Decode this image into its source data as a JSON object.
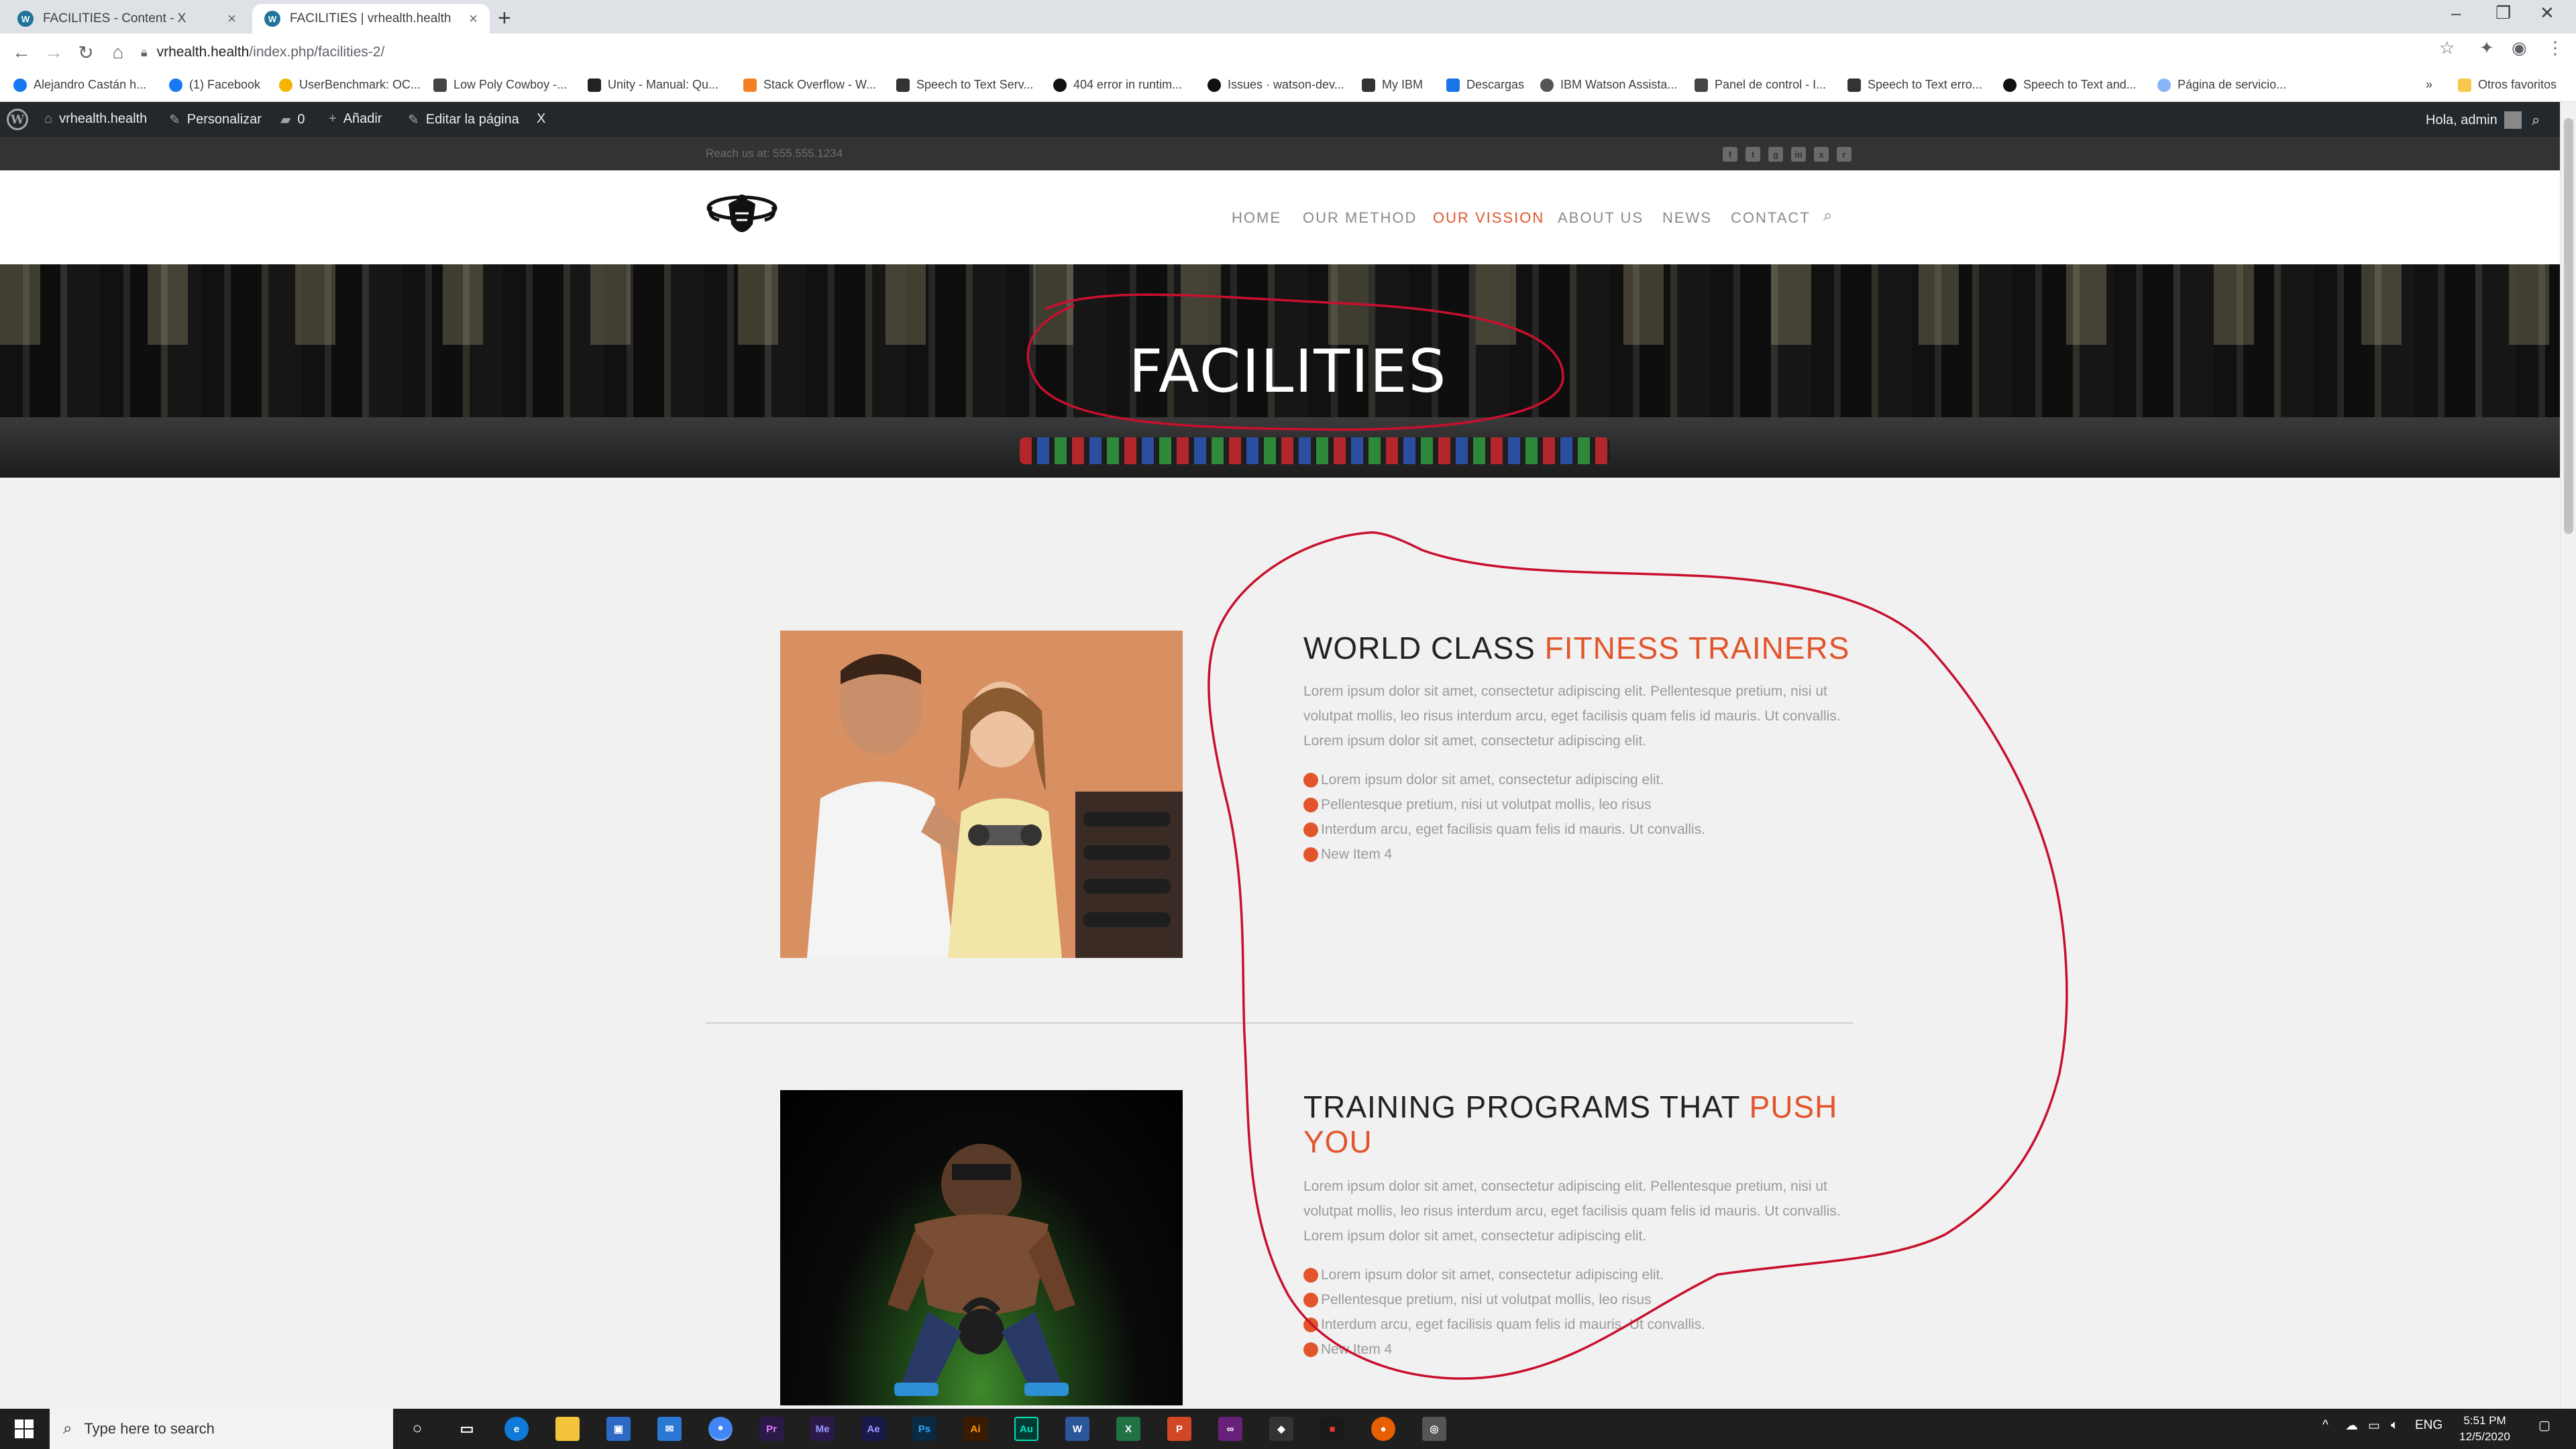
{
  "browser": {
    "tabs": [
      {
        "title": "FACILITIES - Content - X",
        "active": false
      },
      {
        "title": "FACILITIES | vrhealth.health",
        "active": true
      }
    ],
    "url_host": "vrhealth.health",
    "url_path": "/index.php/facilities-2/",
    "bookmarks": [
      "Alejandro Castán h...",
      "(1) Facebook",
      "UserBenchmark: OC...",
      "Low Poly Cowboy -...",
      "Unity - Manual: Qu...",
      "Stack Overflow - W...",
      "Speech to Text Serv...",
      "404 error in runtim...",
      "Issues · watson-dev...",
      "My IBM",
      "Descargas",
      "IBM Watson Assista...",
      "Panel de control - I...",
      "Speech to Text erro...",
      "Speech to Text and...",
      "Página de servicio..."
    ],
    "bookmarks_more": "»",
    "other_bookmarks": "Otros favoritos"
  },
  "wp_admin": {
    "site_name": "vrhealth.health",
    "customize": "Personalizar",
    "comments_count": "0",
    "add_new": "Añadir",
    "edit_page": "Editar la página",
    "extra": "X",
    "greeting": "Hola, admin"
  },
  "site": {
    "reach_text": "Reach us at: 555.555.1234",
    "nav": [
      "HOME",
      "OUR METHOD",
      "OUR VISSION",
      "ABOUT US",
      "NEWS",
      "CONTACT"
    ],
    "active_nav": "OUR VISSION",
    "hero_title": "FACILITIES",
    "sections": [
      {
        "title_plain": "WORLD CLASS ",
        "title_accent": "FITNESS TRAINERS",
        "title_accent_line2": "",
        "paragraph": "Lorem ipsum dolor sit amet, consectetur adipiscing elit. Pellentesque pretium, nisi ut volutpat mollis, leo risus interdum arcu, eget facilisis quam felis id mauris. Ut convallis. Lorem ipsum dolor sit amet, consectetur adipiscing elit.",
        "bullets": [
          "Lorem ipsum dolor sit amet, consectetur adipiscing elit.",
          "Pellentesque pretium, nisi ut volutpat mollis, leo risus",
          "Interdum arcu, eget facilisis quam felis id mauris. Ut convallis.",
          "New Item 4"
        ]
      },
      {
        "title_plain": "TRAINING PROGRAMS THAT ",
        "title_accent": "PUSH",
        "title_accent_line2": "YOU",
        "paragraph": "Lorem ipsum dolor sit amet, consectetur adipiscing elit. Pellentesque pretium, nisi ut volutpat mollis, leo risus interdum arcu, eget facilisis quam felis id mauris. Ut convallis. Lorem ipsum dolor sit amet, consectetur adipiscing elit.",
        "bullets": [
          "Lorem ipsum dolor sit amet, consectetur adipiscing elit.",
          "Pellentesque pretium, nisi ut volutpat mollis, leo risus",
          "Interdum arcu, eget facilisis quam felis id mauris. Ut convallis.",
          "New Item 4"
        ]
      }
    ]
  },
  "taskbar": {
    "search_placeholder": "Type here to search",
    "apps": [
      "Pr",
      "Me",
      "Ae",
      "Ps",
      "Ai",
      "Au",
      "W",
      "X",
      "P"
    ],
    "language": "ENG",
    "time": "5:51 PM",
    "date": "12/5/2020"
  },
  "colors": {
    "accent": "#e2552b",
    "annotation": "#c8102e",
    "wp_bar": "#23282d"
  }
}
